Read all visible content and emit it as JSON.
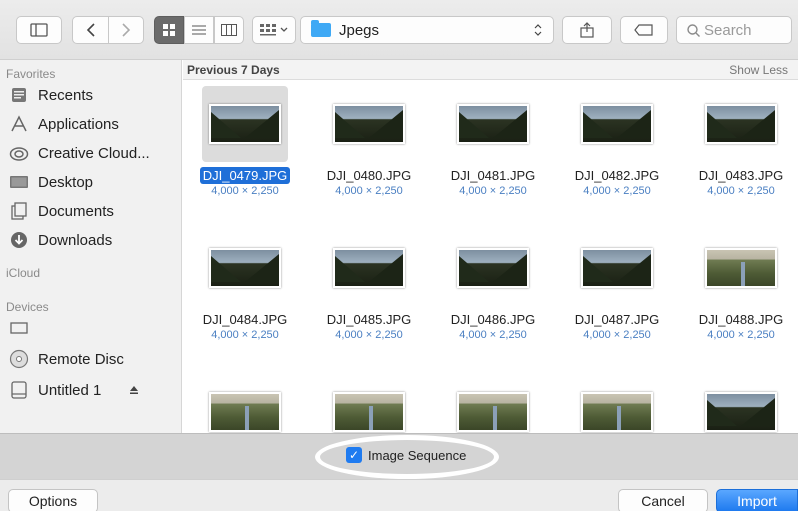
{
  "toolbar": {
    "path_label": "Jpegs",
    "search_placeholder": "Search"
  },
  "sidebar": {
    "favorites_title": "Favorites",
    "favorites": [
      {
        "label": "Recents"
      },
      {
        "label": "Applications"
      },
      {
        "label": "Creative Cloud..."
      },
      {
        "label": "Desktop"
      },
      {
        "label": "Documents"
      },
      {
        "label": "Downloads"
      }
    ],
    "icloud_title": "iCloud",
    "devices_title": "Devices",
    "devices": [
      {
        "label": ""
      },
      {
        "label": "Remote Disc"
      },
      {
        "label": "Untitled 1"
      }
    ]
  },
  "content": {
    "section_title": "Previous 7 Days",
    "show_less": "Show Less",
    "files": [
      {
        "name": "DJI_0479.JPG",
        "dims": "4,000 × 2,250"
      },
      {
        "name": "DJI_0480.JPG",
        "dims": "4,000 × 2,250"
      },
      {
        "name": "DJI_0481.JPG",
        "dims": "4,000 × 2,250"
      },
      {
        "name": "DJI_0482.JPG",
        "dims": "4,000 × 2,250"
      },
      {
        "name": "DJI_0483.JPG",
        "dims": "4,000 × 2,250"
      },
      {
        "name": "DJI_0484.JPG",
        "dims": "4,000 × 2,250"
      },
      {
        "name": "DJI_0485.JPG",
        "dims": "4,000 × 2,250"
      },
      {
        "name": "DJI_0486.JPG",
        "dims": "4,000 × 2,250"
      },
      {
        "name": "DJI_0487.JPG",
        "dims": "4,000 × 2,250"
      },
      {
        "name": "DJI_0488.JPG",
        "dims": "4,000 × 2,250"
      }
    ]
  },
  "accessory": {
    "image_sequence_label": "Image Sequence",
    "image_sequence_checked": true
  },
  "footer": {
    "options_label": "Options",
    "cancel_label": "Cancel",
    "import_label": "Import"
  },
  "colors": {
    "accent": "#1f7bf0",
    "selection": "#1f6fd8",
    "folder": "#3fa9f5"
  }
}
